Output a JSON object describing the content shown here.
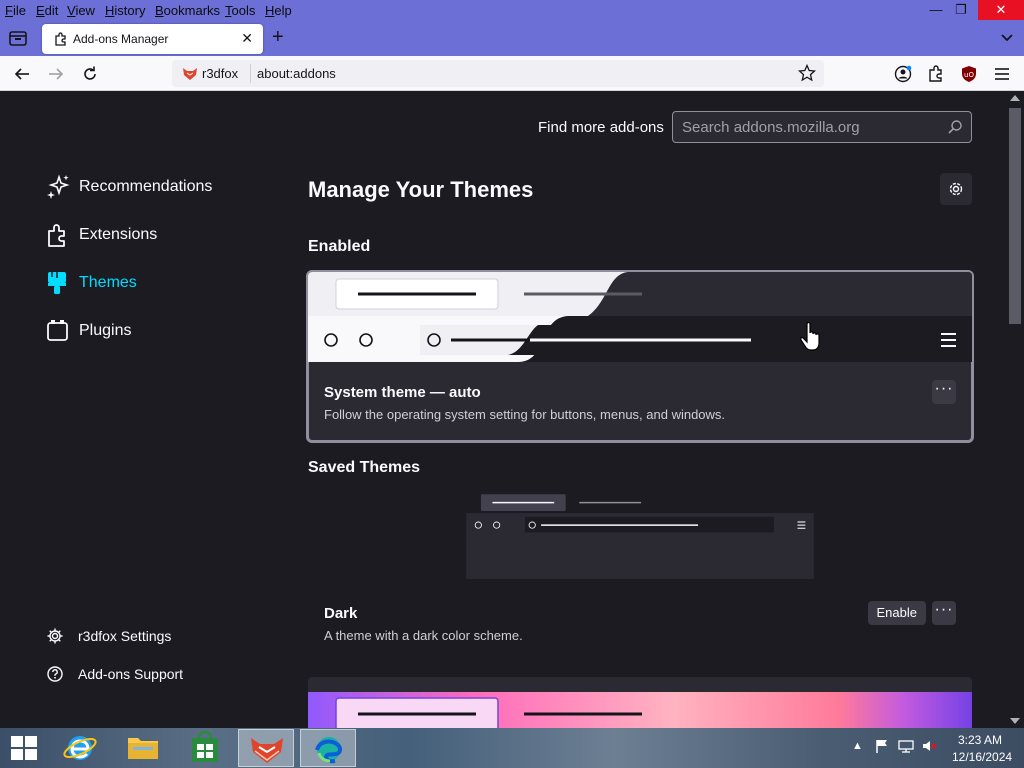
{
  "menubar": {
    "items": [
      "File",
      "Edit",
      "View",
      "History",
      "Bookmarks",
      "Tools",
      "Help"
    ],
    "window_buttons": {
      "minimize": "—",
      "restore": "❐",
      "close": "✕"
    }
  },
  "tab": {
    "title": "Add-ons Manager",
    "close": "✕",
    "new_tab": "+"
  },
  "urlbar": {
    "identity": "r3dfox",
    "url": "about:addons"
  },
  "find_more": {
    "label": "Find more add-ons",
    "placeholder": "Search addons.mozilla.org"
  },
  "sidebar": {
    "categories": [
      {
        "label": "Recommendations",
        "icon": "recommendations-icon"
      },
      {
        "label": "Extensions",
        "icon": "extensions-icon"
      },
      {
        "label": "Themes",
        "icon": "themes-icon",
        "selected": true
      },
      {
        "label": "Plugins",
        "icon": "plugins-icon"
      }
    ],
    "footer": [
      {
        "label": "r3dfox Settings",
        "icon": "gear-icon"
      },
      {
        "label": "Add-ons Support",
        "icon": "help-icon"
      }
    ]
  },
  "main": {
    "heading": "Manage Your Themes",
    "enabled_title": "Enabled",
    "saved_title": "Saved Themes",
    "themes": [
      {
        "name": "System theme — auto",
        "description": "Follow the operating system setting for buttons, menus, and windows.",
        "more": "···"
      },
      {
        "name": "Dark",
        "description": "A theme with a dark color scheme.",
        "enable_label": "Enable",
        "more": "···"
      }
    ]
  },
  "taskbar": {
    "time": "3:23 AM",
    "date": "12/16/2024"
  },
  "colors": {
    "accent": "#00ddff",
    "page_bg": "#1c1b22",
    "card_bg": "#2b2a33",
    "titlebar": "#6b6fd6"
  }
}
